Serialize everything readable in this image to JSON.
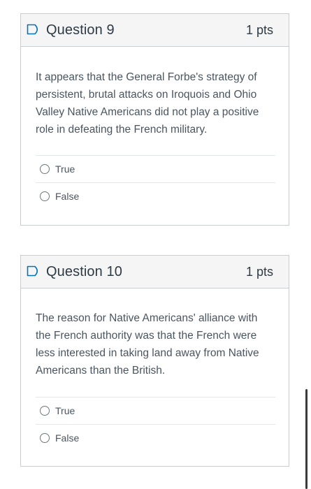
{
  "questions": [
    {
      "title": "Question 9",
      "points": "1 pts",
      "text": "It appears that the General Forbe's strategy of persistent, brutal attacks on Iroquois and Ohio Valley Native Americans did not play a positive role in defeating the French military.",
      "answers": [
        "True",
        "False"
      ]
    },
    {
      "title": "Question 10",
      "points": "1 pts",
      "text": "The reason for Native Americans' alliance with the French authority was that the French were less interested in taking land away from Native Americans than the British.",
      "answers": [
        "True",
        "False"
      ]
    }
  ],
  "colors": {
    "accent": "#0374b5",
    "border": "#c7cdd1",
    "header_bg": "#f5f5f5",
    "text": "#2d3b45"
  },
  "icons": {
    "flag": "flag-outline-icon",
    "radio": "radio-unchecked-icon"
  }
}
